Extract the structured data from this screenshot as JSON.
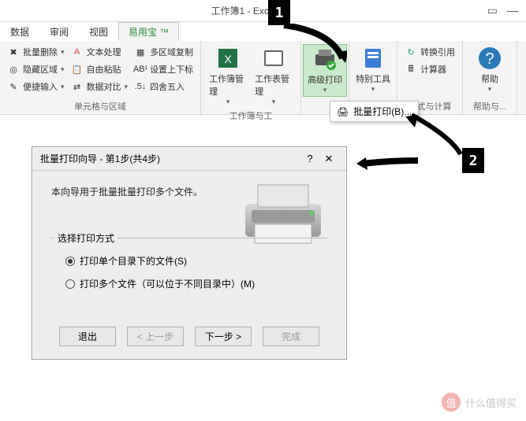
{
  "titlebar": {
    "title": "工作簿1 - Excel"
  },
  "tabs": [
    "数据",
    "审阅",
    "视图",
    "易用宝 ™"
  ],
  "active_tab": 3,
  "ribbon": {
    "group1": {
      "label": "单元格与区域",
      "items": [
        [
          "批量删除",
          "文本处理",
          "多区域复制"
        ],
        [
          "隐藏区域",
          "自由粘贴",
          "设置上下标"
        ],
        [
          "便捷输入",
          "数据对比",
          "四舍五入"
        ]
      ]
    },
    "group2": {
      "label": "工作簿与工",
      "items": [
        "工作簿管理",
        "工作表管理"
      ]
    },
    "group3": {
      "item": "高级打印"
    },
    "group4": {
      "item": "特别工具"
    },
    "group5": {
      "label": "公式与计算",
      "items": [
        "转换引用",
        "计算器"
      ]
    },
    "group6": {
      "label": "帮助与...",
      "item": "帮助"
    }
  },
  "dropdown": {
    "label": "批量打印(B)..."
  },
  "dialog": {
    "title": "批量打印向导 - 第1步(共4步)",
    "desc": "本向导用于批量批量打印多个文件。",
    "fieldset_legend": "选择打印方式",
    "opt1": "打印单个目录下的文件(S)",
    "opt2": "打印多个文件（可以位于不同目录中）(M)",
    "btn_exit": "退出",
    "btn_prev": "< 上一步",
    "btn_next": "下一步 >",
    "btn_finish": "完成"
  },
  "markers": {
    "m1": "1",
    "m2": "2"
  },
  "watermark": {
    "icon": "值",
    "text": "什么值得买"
  }
}
